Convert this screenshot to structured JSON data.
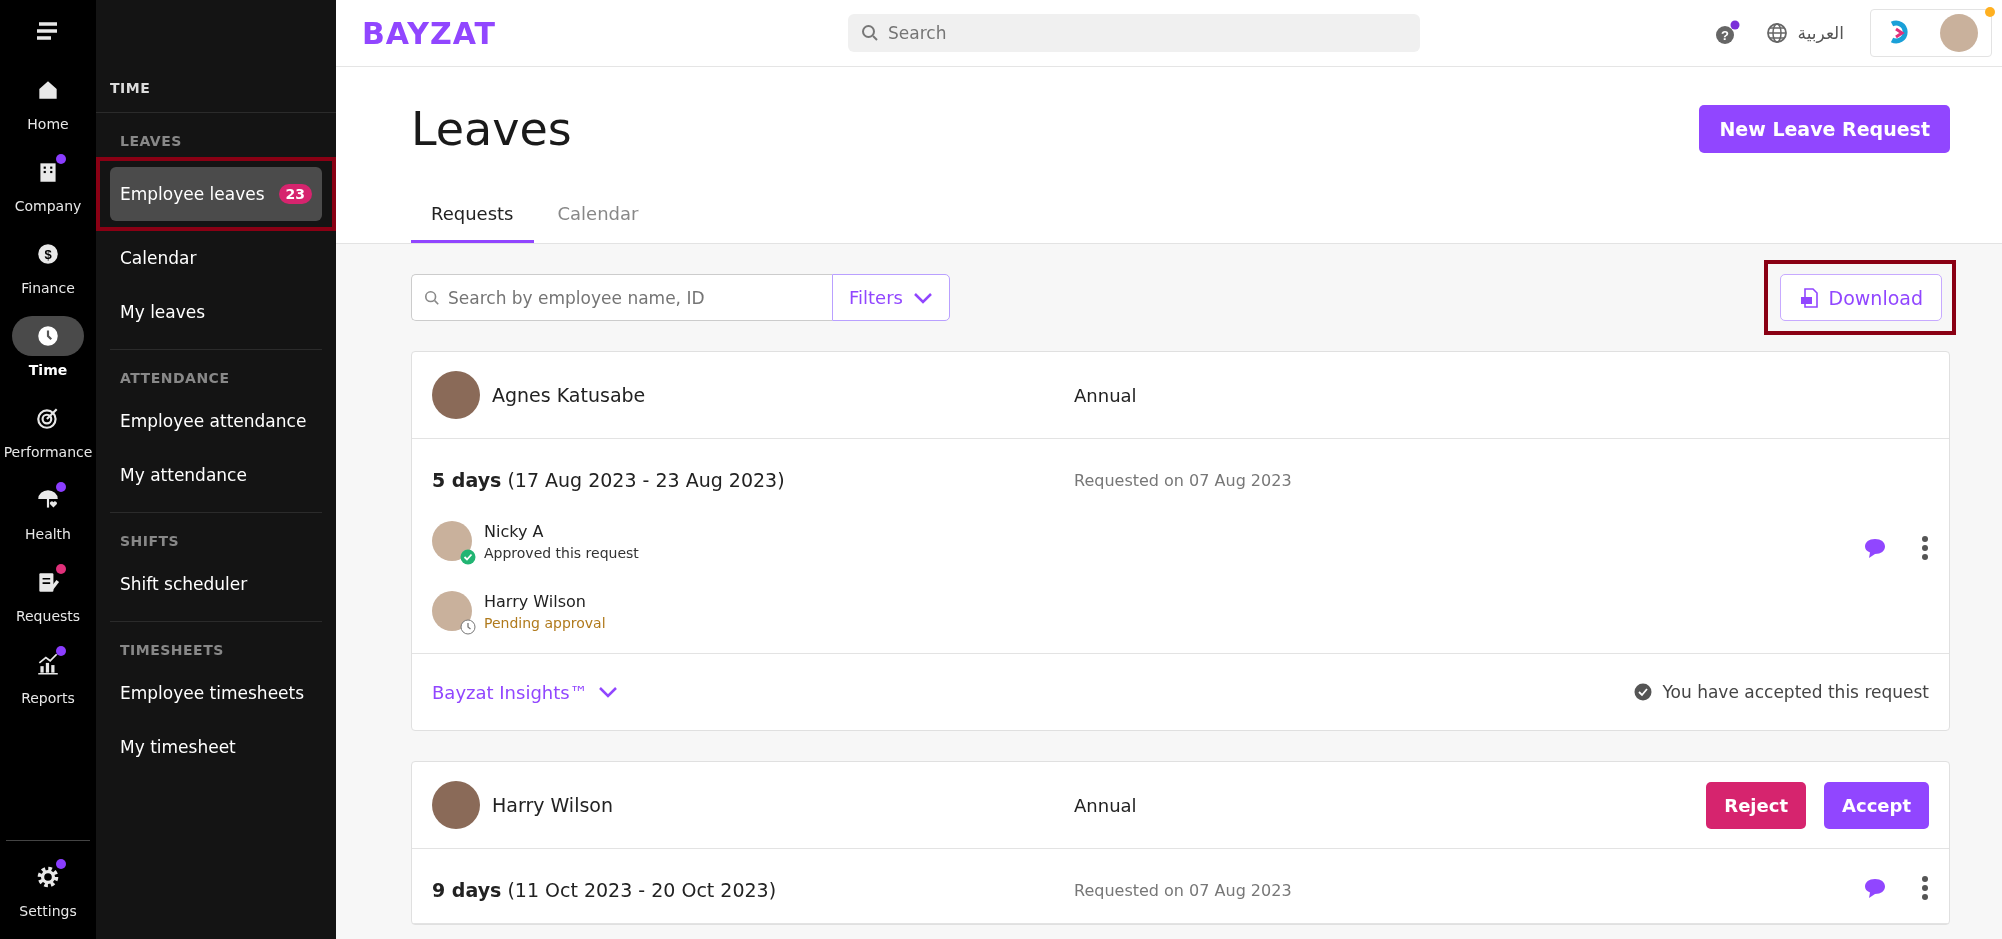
{
  "rail": {
    "items": [
      {
        "kind": "home",
        "label": "Home",
        "selected": false
      },
      {
        "kind": "company",
        "label": "Company",
        "selected": false,
        "color": "#8b3dff"
      },
      {
        "kind": "finance",
        "label": "Finance",
        "selected": false,
        "icon_text": "$"
      },
      {
        "kind": "time",
        "label": "Time",
        "selected": true
      },
      {
        "kind": "performance",
        "label": "Performance",
        "selected": false
      },
      {
        "kind": "health",
        "label": "Health",
        "selected": false,
        "color": "#8b3dff"
      },
      {
        "kind": "requests",
        "label": "Requests",
        "selected": false,
        "color": "#e0307a"
      },
      {
        "kind": "reports",
        "label": "Reports",
        "selected": false,
        "color": "#8b3dff"
      }
    ],
    "settings": {
      "kind": "settings",
      "label": "Settings",
      "selected": false,
      "color": "#8b3dff"
    }
  },
  "sidebar": {
    "title": "TIME",
    "sections": [
      {
        "heading": "LEAVES",
        "items": [
          {
            "label": "Employee leaves",
            "badge": "23",
            "selected": true,
            "highlighted": true
          },
          {
            "label": "Calendar",
            "selected": false,
            "highlighted": false
          },
          {
            "label": "My leaves",
            "selected": false,
            "highlighted": false
          }
        ]
      },
      {
        "heading": "ATTENDANCE",
        "items": [
          {
            "label": "Employee attendance",
            "selected": false,
            "highlighted": false
          },
          {
            "label": "My attendance",
            "selected": false,
            "highlighted": false
          }
        ]
      },
      {
        "heading": "SHIFTS",
        "items": [
          {
            "label": "Shift scheduler",
            "selected": false,
            "highlighted": false
          }
        ]
      },
      {
        "heading": "TIMESHEETS",
        "items": [
          {
            "label": "Employee timesheets",
            "selected": false,
            "highlighted": false
          },
          {
            "label": "My timesheet",
            "selected": false,
            "highlighted": false
          }
        ]
      }
    ]
  },
  "topbar": {
    "logo": "BAYZAT",
    "search": {
      "placeholder": "Search"
    },
    "help": "?",
    "language": "العربية"
  },
  "page": {
    "title": "Leaves",
    "primary_button": "New Leave Request",
    "tabs": [
      {
        "label": "Requests",
        "selected": true
      },
      {
        "label": "Calendar",
        "selected": false
      }
    ],
    "search": {
      "placeholder": "Search by employee name, ID"
    },
    "filters": "Filters",
    "download": {
      "label": "Download",
      "highlighted": true
    }
  },
  "requests": [
    {
      "name": "Agnes Katusabe",
      "leave_type": "Annual",
      "duration": "**5 days** (17 Aug 2023 - 23 Aug 2023)",
      "requested": "Requested on 07 Aug 2023",
      "approvers": [
        {
          "name": "Nicky A",
          "status_text": "Approved this request",
          "approved": true
        },
        {
          "name": "Harry Wilson",
          "status_text": "Pending approval",
          "approved": false
        }
      ],
      "insights": "Bayzat Insights™",
      "result": "You have accepted this request"
    },
    {
      "name": "Harry Wilson",
      "leave_type": "Annual",
      "duration": "**9 days** (11 Oct 2023 - 20 Oct 2023)",
      "requested": "Requested on 07 Aug 2023",
      "actions": [
        {
          "label": "Reject",
          "kind": "reject"
        },
        {
          "label": "Accept",
          "kind": "accept"
        }
      ]
    }
  ]
}
